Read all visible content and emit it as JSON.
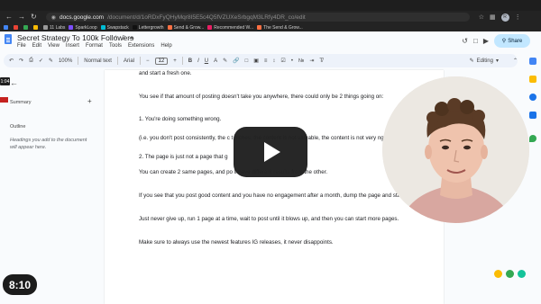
{
  "browser": {
    "url_host": "docs.google.com",
    "url_path": "/document/d/1oRDxFyQHyMqr8I5E5c4Q5fVZUXeSrbgqM3LRfy4DR_co/edit",
    "profile_initial": "R",
    "bookmarks": [
      {
        "label": "",
        "color": "#4285f4"
      },
      {
        "label": "",
        "color": "#ea4335"
      },
      {
        "label": "",
        "color": "#34a853"
      },
      {
        "label": "",
        "color": "#fbbc04"
      },
      {
        "label": "11 Labs",
        "color": "#999999"
      },
      {
        "label": "SparkLoop",
        "color": "#7c4dff"
      },
      {
        "label": "Swapstack",
        "color": "#00bcd4"
      },
      {
        "label": "Lettergrowth",
        "color": "#111111"
      },
      {
        "label": "Send & Grow...",
        "color": "#ff7043"
      },
      {
        "label": "Recommended W...",
        "color": "#e91e63"
      },
      {
        "label": "The Send & Grow...",
        "color": "#ff7043"
      }
    ]
  },
  "doc": {
    "title": "Secret Strategy To 100k Followers",
    "menu": [
      "File",
      "Edit",
      "View",
      "Insert",
      "Format",
      "Tools",
      "Extensions",
      "Help"
    ],
    "share_label": "Share"
  },
  "toolbar": {
    "zoom": "100%",
    "style": "Normal text",
    "font": "Arial",
    "font_size": "12",
    "mode": "Editing"
  },
  "outline": {
    "summary_label": "Summary",
    "outline_label": "Outline",
    "hint": "Headings you add to the document will appear here.",
    "badge": "1:04"
  },
  "page": {
    "paragraphs": [
      "and start a fresh one.",
      "You see if that amount of posting doesn't take you anywhere, there could only be 2 things going on:",
      "1. You're doing something wrong.",
      "(i.e. you don't post consistently, the c                                        t niches, the content is not valuable, the content is not very                                            ngage)",
      "2. The page is just not a page that g",
      "You can create 2 same pages, and po                                                   ll have different results from the other.",
      "If you see that you post good content and you have no engagement after a month, dump the page and start over.",
      "Just never give up, run 1 page at a time, wait to post until it blows up, and then you can start more pages.",
      "Make sure to always use the newest features IG releases, it never disappoints."
    ]
  },
  "video": {
    "duration": "8:10"
  },
  "colors": {
    "share_bg": "#c2e7ff",
    "toolbar_bg": "#edf2fa",
    "play_bg": "#212121"
  }
}
